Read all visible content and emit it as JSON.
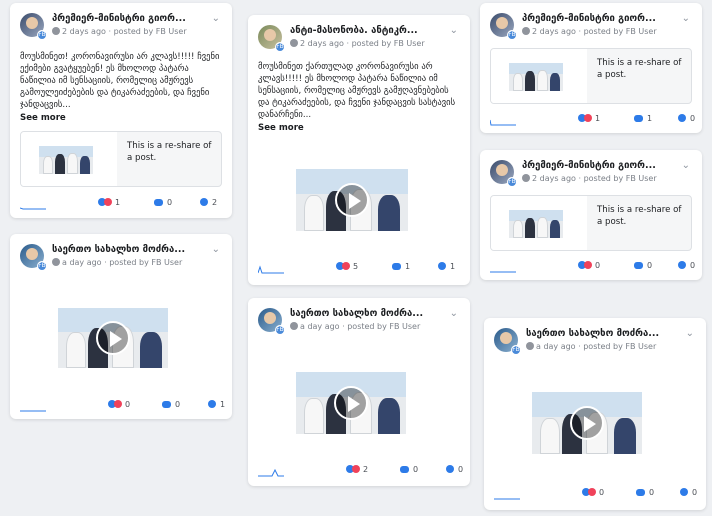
{
  "posts": [
    {
      "author": "პრემიერ-მინისტრი გიორ...",
      "time": "2 days ago",
      "posted_by": "posted by FB User",
      "text": "მოუსმინეთ! კორონავირუსი არ კლავს!!!!! ჩვენი ექიმები გვატყუებენ! ეს მხოლოდ პატარა ნაწილია იმ სენსაციის, რომელიც ამჟრევს გამოულეიძებების და ტიკარაძეების, და ჩვენი ჯანდაცვის...",
      "see_more": "See more",
      "share_text": "This is a re-share of a post.",
      "reactions": "1",
      "comments": "0",
      "shares": "2"
    },
    {
      "author": "ანტი-მასონობა. ანტიკრ...",
      "time": "2 days ago",
      "posted_by": "posted by FB User",
      "text": "მოუსმინეთ ქართულად კორონავირუსი არ კლავს!!!!! ეს მხოლოდ პატარა ნაწილია იმ სენსაციის, რომელიც ამჟრევს გამჟღავნებების და ტიკარაძეების, და ჩვენი ჯანდაცვის სასტავის დანარჩენი...",
      "see_more": "See more",
      "reactions": "5",
      "comments": "1",
      "shares": "1"
    },
    {
      "author": "პრემიერ-მინისტრი გიორ...",
      "time": "2 days ago",
      "posted_by": "posted by FB User",
      "share_text": "This is a re-share of a post.",
      "reactions": "1",
      "comments": "1",
      "shares": "0"
    },
    {
      "author": "პრემიერ-მინისტრი გიორ...",
      "time": "2 days ago",
      "posted_by": "posted by FB User",
      "share_text": "This is a re-share of a post.",
      "reactions": "0",
      "comments": "0",
      "shares": "0"
    },
    {
      "author": "საერთო სახალხო მოძრა...",
      "time": "a day ago",
      "posted_by": "posted by FB User",
      "reactions": "0",
      "comments": "0",
      "shares": "1"
    },
    {
      "author": "საერთო სახალხო მოძრა...",
      "time": "a day ago",
      "posted_by": "posted by FB User",
      "reactions": "2",
      "comments": "0",
      "shares": "0"
    },
    {
      "author": "საერთო სახალხო მოძრა...",
      "time": "a day ago",
      "posted_by": "posted by FB User",
      "reactions": "0",
      "comments": "0",
      "shares": "0"
    }
  ],
  "icons": {
    "avatar_badge": "FB",
    "chevron": "chevron-down-icon",
    "globe": "globe-icon",
    "reaction": "like-love-icon",
    "comment": "comment-icon",
    "share": "share-icon",
    "play": "play-icon"
  },
  "colors": {
    "accent": "#2d7be8",
    "love": "#f0425a",
    "card": "#ffffff",
    "background": "#eef0f3"
  }
}
